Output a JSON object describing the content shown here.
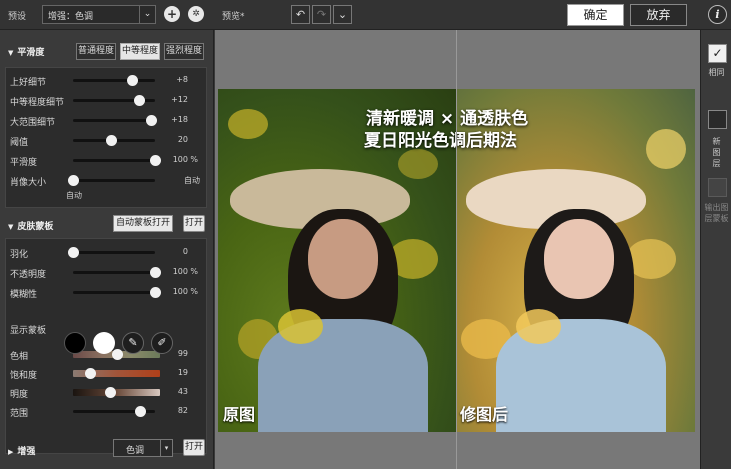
{
  "topbar": {
    "preset_label": "预设",
    "preset_value": "增强：色调",
    "add_symbol": "+",
    "settings_symbol": "✲",
    "preview_label": "预览*",
    "undo_symbol": "↶",
    "redo_symbol": "↷",
    "history_symbol": "⌄",
    "confirm_label": "确定",
    "cancel_label": "放弃",
    "info_symbol": "i"
  },
  "smoothing": {
    "title": "平滑度",
    "strength_buttons": [
      "普通程度",
      "中等程度",
      "强烈程度"
    ],
    "active_strength": "中等程度",
    "sliders": [
      {
        "label": "上好细节",
        "value": "+8",
        "unit": "",
        "level": 0.72
      },
      {
        "label": "中等程度细节",
        "value": "+12",
        "unit": "",
        "level": 0.8
      },
      {
        "label": "大范围细节",
        "value": "+18",
        "unit": "",
        "level": 0.95
      },
      {
        "label": "阈值",
        "value": "20",
        "unit": "",
        "level": 0.46
      },
      {
        "label": "平滑度",
        "value": "100",
        "unit": "%",
        "level": 1.0
      },
      {
        "label": "肖像大小",
        "value": "自动",
        "unit": "",
        "level": 0.0
      }
    ],
    "auto_label": "自动"
  },
  "skin_mask": {
    "title": "皮肤蒙板",
    "auto_mask_label": "自动蒙板打开",
    "open_label": "打开",
    "sliders": [
      {
        "label": "羽化",
        "value": "0",
        "unit": "",
        "level": 0.0
      },
      {
        "label": "不透明度",
        "value": "100",
        "unit": "%",
        "level": 1.0
      },
      {
        "label": "模糊性",
        "value": "100",
        "unit": "%",
        "level": 1.0
      }
    ],
    "show_mask_label": "显示蒙板",
    "picker_plus": "✎",
    "picker_minus": "✐",
    "color_sliders": [
      {
        "label": "色相",
        "value": "99",
        "level": 0.5
      },
      {
        "label": "饱和度",
        "value": "19",
        "level": 0.2
      },
      {
        "label": "明度",
        "value": "43",
        "level": 0.43
      },
      {
        "label": "范围",
        "value": "82",
        "level": 0.82
      }
    ]
  },
  "enhance": {
    "title": "增强",
    "dropdown_value": "色调",
    "open_label": "打开"
  },
  "preview": {
    "banner_line1": "清新暖调 × 通透肤色",
    "banner_line2": "夏日阳光色调后期法",
    "left_caption": "原图",
    "right_caption": "修图后"
  },
  "right_panel": {
    "same_label": "相同",
    "new_layer_label": "新图层",
    "output_mask_label": "输出图层蒙板",
    "check_symbol": "✓"
  },
  "colors": {
    "swatch_black": "#000000",
    "swatch_white": "#ffffff",
    "hue_gradient": "linear-gradient(to right, #6a4a48, #8a7060, #8a8a6a, #6b7a5a)",
    "sat_gradient": "linear-gradient(to right, #8a7a72, #a2553a, #b0401a)",
    "lum_gradient": "linear-gradient(to right, #1a1410, #6a4a3a, #d8c8c0)"
  }
}
